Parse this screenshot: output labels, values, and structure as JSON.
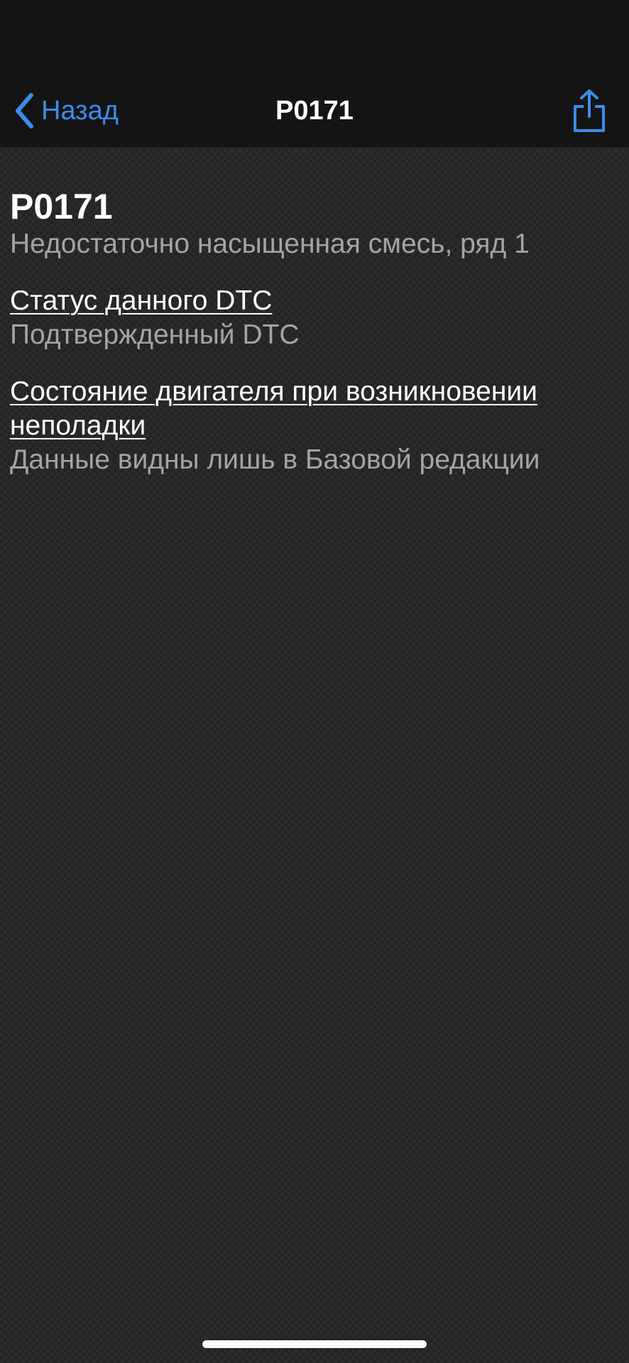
{
  "nav": {
    "back_label": "Назад",
    "title": "P0171",
    "back_icon": "chevron-left-icon",
    "share_icon": "share-icon",
    "accent_color": "#3b8ced"
  },
  "dtc": {
    "code": "P0171",
    "description": "Недостаточно насыщенная смесь, ряд 1"
  },
  "sections": [
    {
      "heading": "Статус данного DTC",
      "value": "Подтвержденный DTC"
    },
    {
      "heading": "Состояние двигателя при возникновении неполадки",
      "value": "Данные видны лишь в Базовой редакции"
    }
  ]
}
